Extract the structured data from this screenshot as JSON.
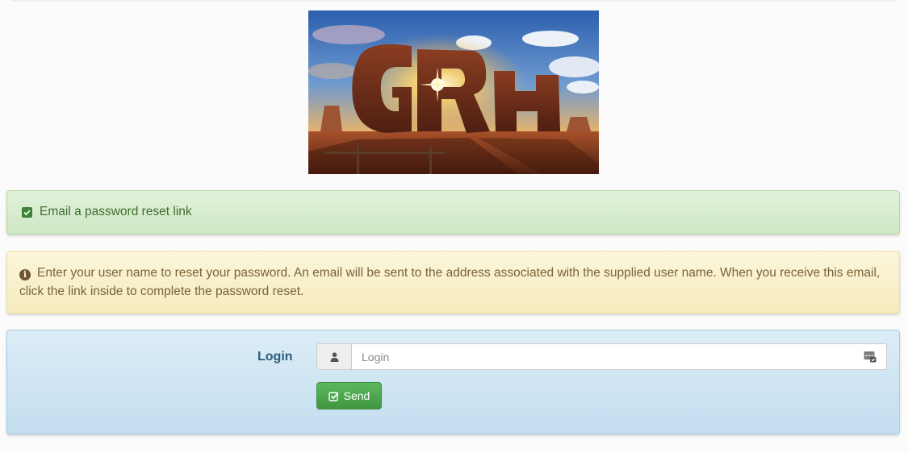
{
  "banner": {
    "logo_text": "GRH"
  },
  "success_panel": {
    "icon": "check-square-icon",
    "text": "Email a password reset link"
  },
  "warning_panel": {
    "icon": "info-circle-icon",
    "text": "Enter your user name to reset your password. An email will be sent to the address associated with the supplied user name. When you receive this email, click the link inside to complete the password reset."
  },
  "form": {
    "login_label": "Login",
    "login_placeholder": "Login",
    "login_value": "",
    "user_icon": "user-icon",
    "password_manager_icon": "password-manager-icon",
    "send_label": "Send",
    "send_icon": "check-square-o-icon"
  },
  "colors": {
    "success_text": "#3c6f31",
    "warning_text": "#7b6336",
    "info_text": "#2c5c7e",
    "send_button": "#5cb85c"
  }
}
